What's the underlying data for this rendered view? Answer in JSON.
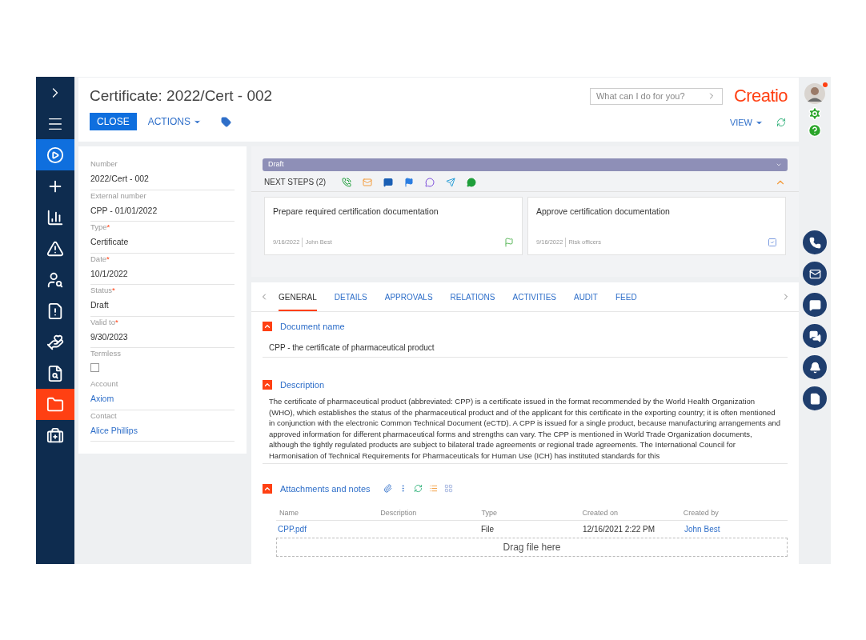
{
  "nav": [
    {
      "kind": "expand",
      "selected": false
    },
    {
      "kind": "menu",
      "selected": false
    },
    {
      "kind": "run",
      "selected": false
    },
    {
      "kind": "add",
      "selected": false
    },
    {
      "kind": "chart",
      "selected": false
    },
    {
      "kind": "warning",
      "selected": false
    },
    {
      "kind": "inspector",
      "selected": false
    },
    {
      "kind": "document",
      "selected": false
    },
    {
      "kind": "hands",
      "selected": false
    },
    {
      "kind": "search-doc",
      "selected": false
    },
    {
      "kind": "folder",
      "selected": true
    },
    {
      "kind": "case",
      "selected": false
    }
  ],
  "header": {
    "title": "Certificate: 2022/Cert - 002",
    "close": "CLOSE",
    "actions": "ACTIONS",
    "search_placeholder": "What can I do for you?",
    "logo": "Creatio",
    "view": "VIEW"
  },
  "fields": [
    {
      "kind": "text",
      "label": "Number",
      "value": "2022/Cert - 002"
    },
    {
      "kind": "text",
      "label": "External number",
      "value": "CPP - 01/01/2022"
    },
    {
      "kind": "text",
      "label": "Type",
      "required_mark": "*",
      "value": "Certificate"
    },
    {
      "kind": "text",
      "label": "Date",
      "required_mark": "*",
      "value": "10/1/2022"
    },
    {
      "kind": "text",
      "label": "Status",
      "required_mark": "*",
      "value": "Draft"
    },
    {
      "kind": "text",
      "label": "Valid to",
      "required_mark": "*",
      "value": "9/30/2023"
    },
    {
      "kind": "checkbox",
      "label": "Termless",
      "checked": false
    },
    {
      "kind": "link",
      "label": "Account",
      "value": "Axiom"
    },
    {
      "kind": "link",
      "label": "Contact",
      "value": "Alice Phillips"
    }
  ],
  "stage": "Draft",
  "next_steps": {
    "label": "NEXT STEPS (2)",
    "expanded": true,
    "tasks": [
      {
        "kind": "flag",
        "title": "Prepare required certification documentation",
        "date": "9/16/2022",
        "owner": "John Best"
      },
      {
        "kind": "approval",
        "title": "Approve certification documentation",
        "date": "9/16/2022",
        "owner": "Risk officers"
      }
    ]
  },
  "tabs": [
    {
      "label": "GENERAL",
      "selected": true
    },
    {
      "label": "DETAILS",
      "selected": false
    },
    {
      "label": "APPROVALS",
      "selected": false
    },
    {
      "label": "RELATIONS",
      "selected": false
    },
    {
      "label": "ACTIVITIES",
      "selected": false
    },
    {
      "label": "AUDIT",
      "selected": false
    },
    {
      "label": "FEED",
      "selected": false
    }
  ],
  "document_name": {
    "title": "Document name",
    "value": "CPP - the certificate of pharmaceutical product",
    "expanded": true
  },
  "description": {
    "title": "Description",
    "expanded": true,
    "text": "The certificate of pharmaceutical product (abbreviated: CPP) is a certificate issued in the format recommended by the World Health Organization (WHO), which establishes the status of the pharmaceutical product and of the applicant for this certificate in the exporting country; it is often mentioned in conjunction with the electronic Common Technical Document (eCTD). A CPP is issued for a single product, because manufacturing arrangements and approved information for different pharmaceutical forms and strengths can vary. The CPP is mentioned in World Trade Organization documents, although the tightly regulated products are subject to bilateral trade agreements or regional trade agreements. The International Council for Harmonisation of Technical Requirements for Pharmaceuticals for Human Use (ICH) has instituted standards for this"
  },
  "attachments": {
    "title": "Attachments and notes",
    "expanded": true,
    "columns": [
      "Name",
      "Description",
      "Type",
      "Created on",
      "Created by"
    ],
    "rows": [
      {
        "name": "CPP.pdf",
        "type": "File",
        "created_on": "12/16/2021 2:22 PM",
        "created_by": "John Best"
      }
    ],
    "drop": "Drag file here"
  },
  "right_bar": {
    "notification": true
  }
}
